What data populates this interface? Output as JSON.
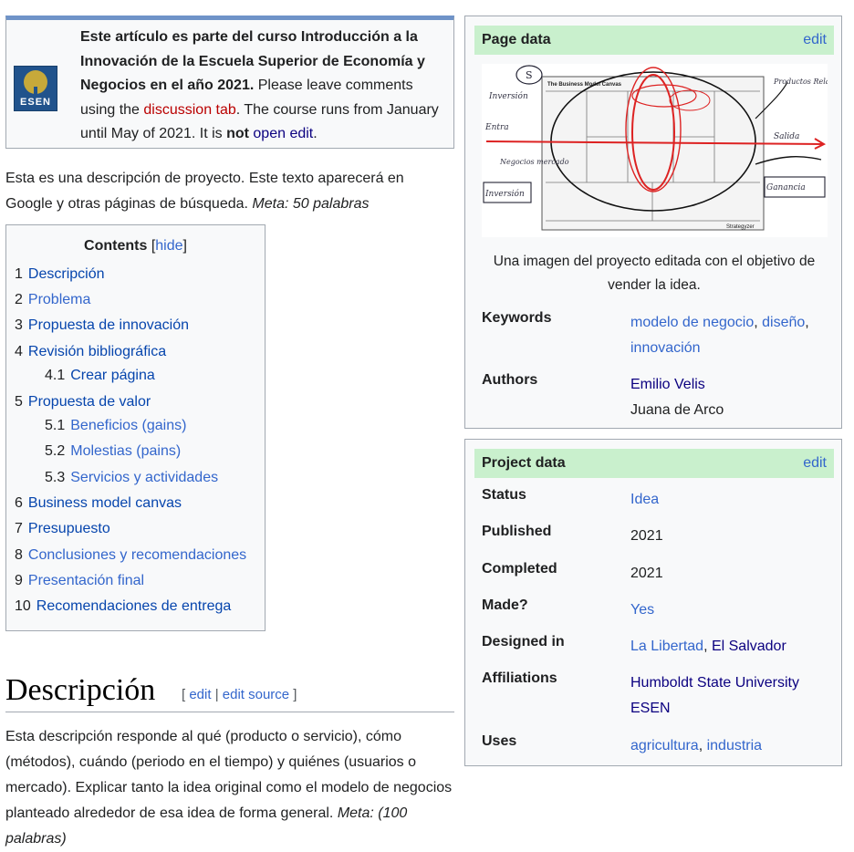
{
  "notice": {
    "logo_text": "ESEN",
    "lead": "Este artículo es parte del curso Introducción a la Innovación de la Escuela Superior de Economía y Negocios en el año 2021.",
    "text1": " Please leave comments using the ",
    "link_discussion": "discussion tab",
    "text2": ". The course runs from January until May of 2021. It is ",
    "bold_not": "not",
    "text3": " ",
    "link_open_edit": "open edit",
    "text4": "."
  },
  "intro": {
    "text": "Esta es una descripción de proyecto. Este texto aparecerá en Google y otras páginas de búsqueda. ",
    "meta": "Meta: 50 palabras"
  },
  "toc": {
    "title": "Contents",
    "hide_open": "[",
    "hide": "hide",
    "hide_close": "]",
    "items": [
      {
        "num": "1",
        "label": "Descripción"
      },
      {
        "num": "2",
        "label": "Problema"
      },
      {
        "num": "3",
        "label": "Propuesta de innovación"
      },
      {
        "num": "4",
        "label": "Revisión bibliográfica"
      },
      {
        "num": "4.1",
        "label": "Crear página"
      },
      {
        "num": "5",
        "label": "Propuesta de valor"
      },
      {
        "num": "5.1",
        "label": "Beneficios (gains)"
      },
      {
        "num": "5.2",
        "label": "Molestias (pains)"
      },
      {
        "num": "5.3",
        "label": "Servicios y actividades"
      },
      {
        "num": "6",
        "label": "Business model canvas"
      },
      {
        "num": "7",
        "label": "Presupuesto"
      },
      {
        "num": "8",
        "label": "Conclusiones y recomendaciones"
      },
      {
        "num": "9",
        "label": "Presentación final"
      },
      {
        "num": "10",
        "label": "Recomendaciones de entrega"
      }
    ]
  },
  "section": {
    "heading": "Descripción",
    "bracket_open": "[ ",
    "edit": "edit",
    "sep": " | ",
    "edit_source": "edit source",
    "bracket_close": " ]",
    "body": "Esta descripción responde al qué (producto o servicio), cómo (métodos), cuándo (periodo en el tiempo) y quiénes (usuarios o mercado). Explicar tanto la idea original como el modelo de negocios planteado alrededor de esa idea de forma general. ",
    "body_meta": "Meta: (100 palabras)"
  },
  "page_data": {
    "title": "Page data",
    "edit": "edit",
    "image_title": "The Business Model Canvas",
    "image_brand": "Strategyzer",
    "image_notes": [
      "Productos Relaciones",
      "Salida",
      "Ganancia",
      "Entra",
      "Inversión",
      "Negocios mercado",
      "Inversión"
    ],
    "caption": "Una imagen del proyecto editada con el objetivo de vender la idea.",
    "keywords_label": "Keywords",
    "keywords": [
      "modelo de negocio",
      "diseño",
      "innovación"
    ],
    "kw_sep": ", ",
    "authors_label": "Authors",
    "author1": "Emilio Velis",
    "author2": "Juana de Arco"
  },
  "project_data": {
    "title": "Project data",
    "edit": "edit",
    "status_label": "Status",
    "status": "Idea",
    "published_label": "Published",
    "published": "2021",
    "completed_label": "Completed",
    "completed": "2021",
    "made_label": "Made?",
    "made": "Yes",
    "designed_label": "Designed in",
    "designed_1": "La Libertad",
    "designed_sep": ", ",
    "designed_2": "El Salvador",
    "affil_label": "Affiliations",
    "affil_1": "Humboldt State University",
    "affil_2": "ESEN",
    "uses_label": "Uses",
    "uses_1": "agricultura",
    "uses_sep": ", ",
    "uses_2": "industria"
  },
  "colors": {
    "link": "#3366cc",
    "link_dark": "#0b0080",
    "link_red": "#ba0000",
    "header_green": "#c9f0cd",
    "notice_top": "#6f93c8"
  }
}
